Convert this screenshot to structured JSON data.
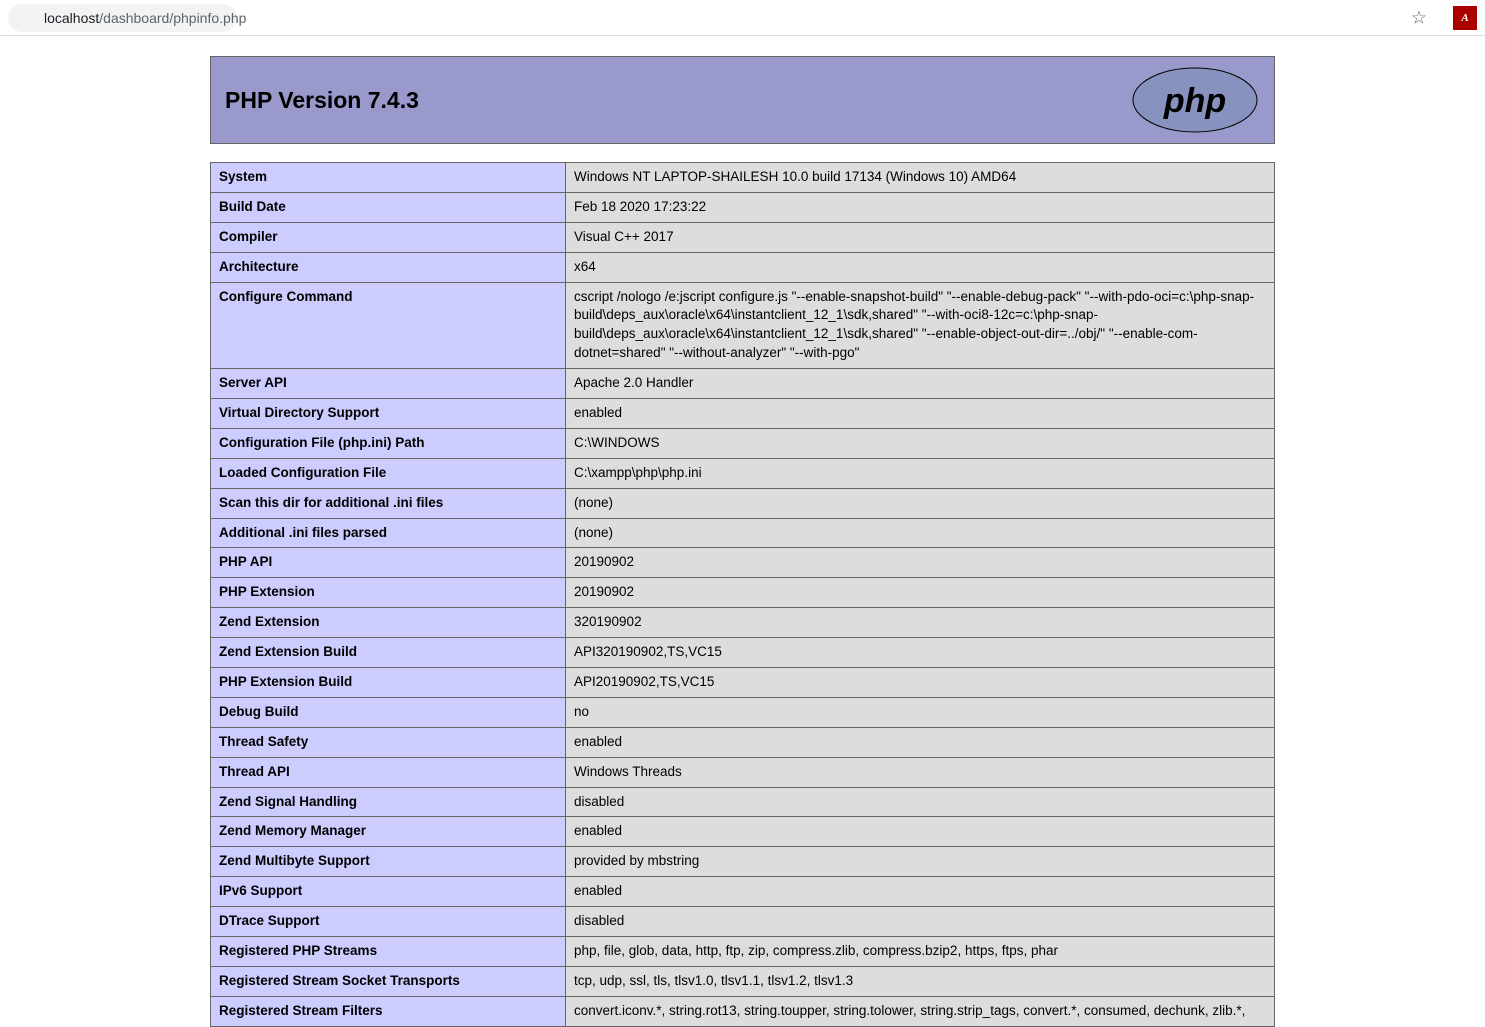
{
  "browser": {
    "url_host": "localhost",
    "url_path": "/dashboard/phpinfo.php",
    "ext_label": "A"
  },
  "header": {
    "title": "PHP Version 7.4.3"
  },
  "rows": [
    {
      "key": "System",
      "val": "Windows NT LAPTOP-SHAILESH 10.0 build 17134 (Windows 10) AMD64"
    },
    {
      "key": "Build Date",
      "val": "Feb 18 2020 17:23:22"
    },
    {
      "key": "Compiler",
      "val": "Visual C++ 2017"
    },
    {
      "key": "Architecture",
      "val": "x64"
    },
    {
      "key": "Configure Command",
      "val": "cscript /nologo /e:jscript configure.js \"--enable-snapshot-build\" \"--enable-debug-pack\" \"--with-pdo-oci=c:\\php-snap-build\\deps_aux\\oracle\\x64\\instantclient_12_1\\sdk,shared\" \"--with-oci8-12c=c:\\php-snap-build\\deps_aux\\oracle\\x64\\instantclient_12_1\\sdk,shared\" \"--enable-object-out-dir=../obj/\" \"--enable-com-dotnet=shared\" \"--without-analyzer\" \"--with-pgo\""
    },
    {
      "key": "Server API",
      "val": "Apache 2.0 Handler"
    },
    {
      "key": "Virtual Directory Support",
      "val": "enabled"
    },
    {
      "key": "Configuration File (php.ini) Path",
      "val": "C:\\WINDOWS"
    },
    {
      "key": "Loaded Configuration File",
      "val": "C:\\xampp\\php\\php.ini"
    },
    {
      "key": "Scan this dir for additional .ini files",
      "val": "(none)"
    },
    {
      "key": "Additional .ini files parsed",
      "val": "(none)"
    },
    {
      "key": "PHP API",
      "val": "20190902"
    },
    {
      "key": "PHP Extension",
      "val": "20190902"
    },
    {
      "key": "Zend Extension",
      "val": "320190902"
    },
    {
      "key": "Zend Extension Build",
      "val": "API320190902,TS,VC15"
    },
    {
      "key": "PHP Extension Build",
      "val": "API20190902,TS,VC15"
    },
    {
      "key": "Debug Build",
      "val": "no"
    },
    {
      "key": "Thread Safety",
      "val": "enabled"
    },
    {
      "key": "Thread API",
      "val": "Windows Threads"
    },
    {
      "key": "Zend Signal Handling",
      "val": "disabled"
    },
    {
      "key": "Zend Memory Manager",
      "val": "enabled"
    },
    {
      "key": "Zend Multibyte Support",
      "val": "provided by mbstring"
    },
    {
      "key": "IPv6 Support",
      "val": "enabled"
    },
    {
      "key": "DTrace Support",
      "val": "disabled"
    },
    {
      "key": "Registered PHP Streams",
      "val": "php, file, glob, data, http, ftp, zip, compress.zlib, compress.bzip2, https, ftps, phar"
    },
    {
      "key": "Registered Stream Socket Transports",
      "val": "tcp, udp, ssl, tls, tlsv1.0, tlsv1.1, tlsv1.2, tlsv1.3"
    },
    {
      "key": "Registered Stream Filters",
      "val": "convert.iconv.*, string.rot13, string.toupper, string.tolower, string.strip_tags, convert.*, consumed, dechunk, zlib.*,"
    }
  ]
}
